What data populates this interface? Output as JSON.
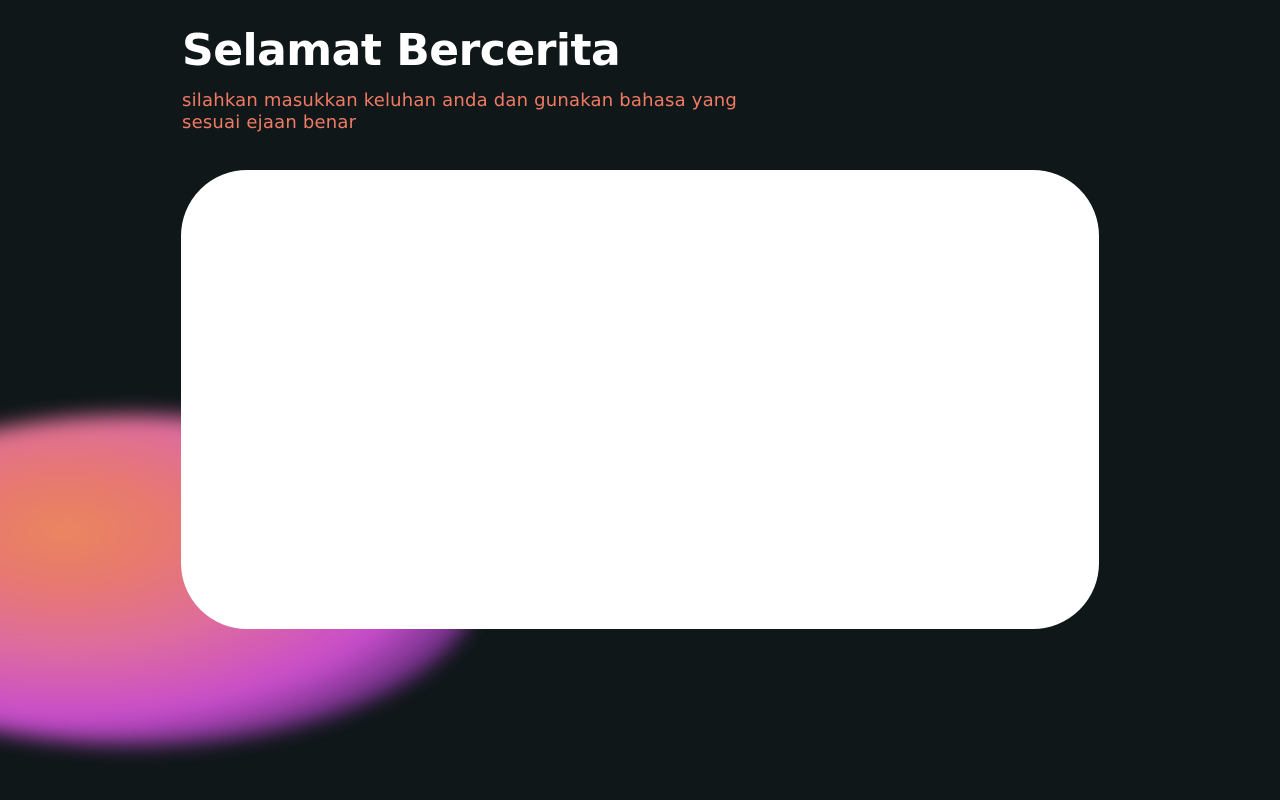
{
  "header": {
    "title": "Selamat Bercerita",
    "subtitle": "silahkan masukkan keluhan anda dan gunakan bahasa yang sesuai ejaan benar"
  },
  "complaint_input": {
    "value": "",
    "placeholder": ""
  },
  "colors": {
    "background": "#0f1719",
    "title": "#ffffff",
    "subtitle": "#f07a63",
    "card": "#ffffff",
    "glow_orange": "#f08a60",
    "glow_pink": "#e46fa0",
    "glow_purple": "#cc4ed0"
  }
}
